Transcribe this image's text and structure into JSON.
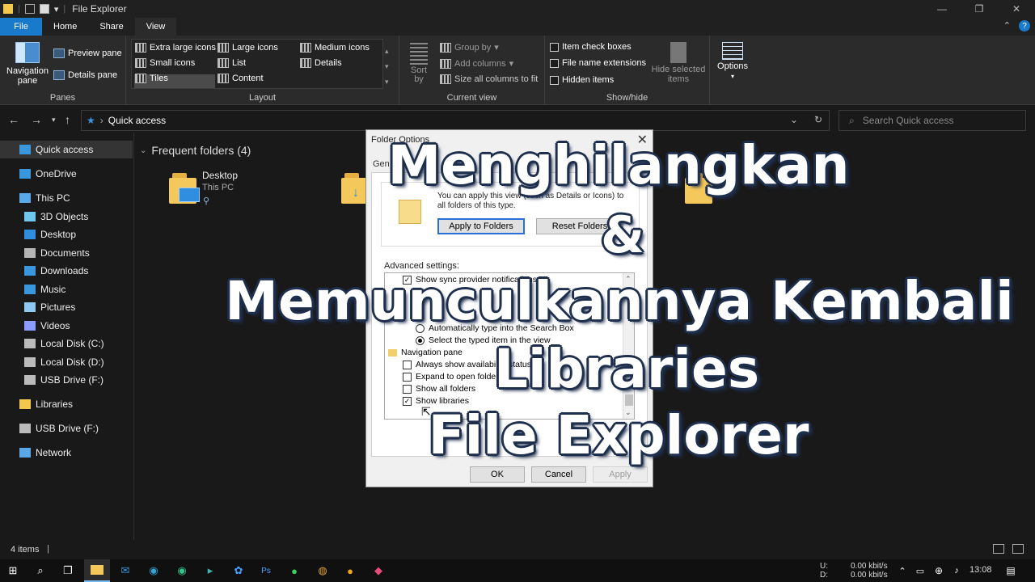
{
  "window": {
    "title": "File Explorer",
    "minimize": "—",
    "restore": "❐",
    "close": "✕"
  },
  "tabs": {
    "file": "File",
    "home": "Home",
    "share": "Share",
    "view": "View",
    "collapse": "⌃",
    "help": "?"
  },
  "ribbon": {
    "panes": {
      "navigation_pane": "Navigation pane",
      "preview_pane": "Preview pane",
      "details_pane": "Details pane",
      "label": "Panes"
    },
    "layout": {
      "extra_large_icons": "Extra large icons",
      "large_icons": "Large icons",
      "medium_icons": "Medium icons",
      "small_icons": "Small icons",
      "list": "List",
      "details": "Details",
      "tiles": "Tiles",
      "content": "Content",
      "label": "Layout"
    },
    "current_view": {
      "sort_by": "Sort by",
      "group_by": "Group by",
      "add_columns": "Add columns",
      "size_all_columns": "Size all columns to fit",
      "label": "Current view"
    },
    "show_hide": {
      "item_check_boxes": "Item check boxes",
      "file_name_extensions": "File name extensions",
      "hidden_items": "Hidden items",
      "hide_selected_items": "Hide selected items",
      "label": "Show/hide"
    },
    "options": "Options"
  },
  "address": {
    "location": "Quick access",
    "search_placeholder": "Search Quick access"
  },
  "nav_pane": {
    "items": [
      {
        "label": "Quick access",
        "icon": "star-icon"
      },
      {
        "label": "OneDrive",
        "icon": "cloud-icon"
      },
      {
        "label": "This PC",
        "icon": "pc-icon"
      },
      {
        "label": "3D Objects",
        "icon": "cube-icon"
      },
      {
        "label": "Desktop",
        "icon": "desktop-icon"
      },
      {
        "label": "Documents",
        "icon": "document-icon"
      },
      {
        "label": "Downloads",
        "icon": "download-icon"
      },
      {
        "label": "Music",
        "icon": "music-icon"
      },
      {
        "label": "Pictures",
        "icon": "picture-icon"
      },
      {
        "label": "Videos",
        "icon": "video-icon"
      },
      {
        "label": "Local Disk (C:)",
        "icon": "disk-icon"
      },
      {
        "label": "Local Disk (D:)",
        "icon": "disk-icon"
      },
      {
        "label": "USB Drive (F:)",
        "icon": "usb-icon"
      },
      {
        "label": "Libraries",
        "icon": "library-icon"
      },
      {
        "label": "USB Drive (F:)",
        "icon": "usb-icon"
      },
      {
        "label": "Network",
        "icon": "network-icon"
      }
    ]
  },
  "content": {
    "group_header": "Frequent folders (4)",
    "tiles": [
      {
        "title": "Desktop",
        "subtitle": "This PC"
      }
    ]
  },
  "dialog": {
    "title": "Folder Options",
    "tab": "Gen",
    "folder_views_text": "You can apply this view (such as Details or Icons) to all folders of this type.",
    "apply_to_folders": "Apply to Folders",
    "reset_folders": "Reset Folders",
    "advanced_label": "Advanced settings:",
    "tree": {
      "show_sync": "Show sync provider notifications",
      "auto_type": "Automatically type into the Search Box",
      "select_typed": "Select the typed item in the view",
      "navigation_pane": "Navigation pane",
      "always_show": "Always show availability status",
      "expand_open": "Expand to open folder",
      "show_all_folders": "Show all folders",
      "show_libraries": "Show libraries"
    },
    "ok": "OK",
    "cancel": "Cancel",
    "apply": "Apply"
  },
  "overlay": {
    "line1": "Menghilangkan",
    "line2": "&",
    "line3": "Memunculkannya Kembali",
    "line4": "Libraries",
    "line5": "File Explorer"
  },
  "status": {
    "items": "4 items"
  },
  "taskbar": {
    "net_u_label": "U:",
    "net_d_label": "D:",
    "net_u": "0.00 kbit/s",
    "net_d": "0.00 kbit/s",
    "time": "13:08"
  },
  "colors": {
    "accent": "#1979ca",
    "overlay_outline": "#1e2f4d",
    "folder": "#f4c85a"
  }
}
